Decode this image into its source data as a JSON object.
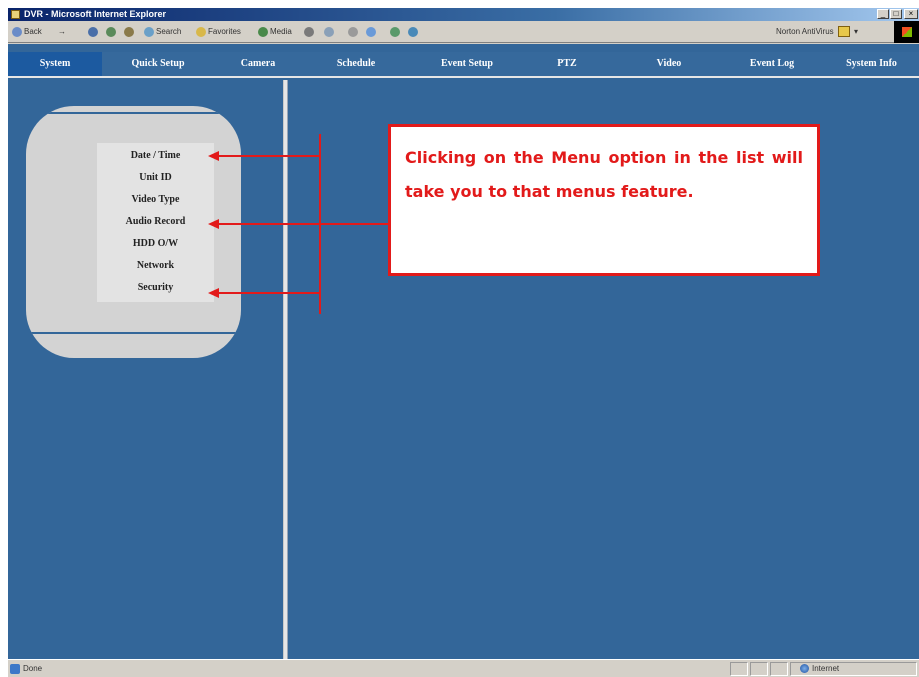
{
  "window": {
    "title": "DVR - Microsoft Internet Explorer",
    "controls": {
      "minimize": "_",
      "maximize": "□",
      "close": "×"
    }
  },
  "toolbar": {
    "back": "Back",
    "forward": "→",
    "search": "Search",
    "favorites": "Favorites",
    "media": "Media",
    "norton": "Norton AntiVirus",
    "norton_dropdown": "▾"
  },
  "nav": {
    "items": [
      {
        "label": "System",
        "active": true
      },
      {
        "label": "Quick Setup"
      },
      {
        "label": "Camera"
      },
      {
        "label": "Schedule"
      },
      {
        "label": "Event Setup"
      },
      {
        "label": "PTZ"
      },
      {
        "label": "Video"
      },
      {
        "label": "Event Log"
      },
      {
        "label": "System Info"
      }
    ]
  },
  "menu": {
    "items": [
      "Date / Time",
      "Unit ID",
      "Video Type",
      "Audio Record",
      "HDD O/W",
      "Network",
      "Security"
    ]
  },
  "callout": {
    "text": "Clicking on the Menu option in the list will take you to that menus feature."
  },
  "status": {
    "text": "Done",
    "zone": "Internet"
  },
  "colors": {
    "page_background": "#336699",
    "annotation": "#e21a1a",
    "active_tab": "#1c5aa0"
  }
}
